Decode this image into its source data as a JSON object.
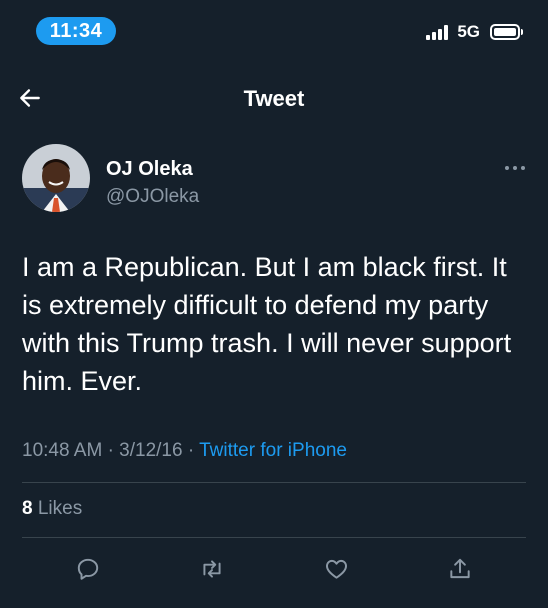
{
  "status_bar": {
    "time": "11:34",
    "network": "5G",
    "icons": [
      "signal-icon",
      "battery-icon"
    ]
  },
  "header": {
    "title": "Tweet",
    "back_icon": "arrow-left-icon"
  },
  "author": {
    "name": "OJ Oleka",
    "handle": "@OJOleka",
    "more_icon": "more-horizontal-icon"
  },
  "tweet": {
    "text": "I am a Republican. But I am black first. It is extremely difficult to defend my party with this Trump trash. I will never support him. Ever.",
    "time": "10:48 AM",
    "date": "3/12/16",
    "source": "Twitter for iPhone"
  },
  "stats": {
    "likes_count": "8",
    "likes_label": "Likes"
  },
  "actions": [
    "reply-icon",
    "retweet-icon",
    "like-icon",
    "share-icon"
  ],
  "colors": {
    "background": "#15202b",
    "accent": "#1d9bf0",
    "secondary_text": "#8b98a5",
    "divider": "#38444d"
  }
}
